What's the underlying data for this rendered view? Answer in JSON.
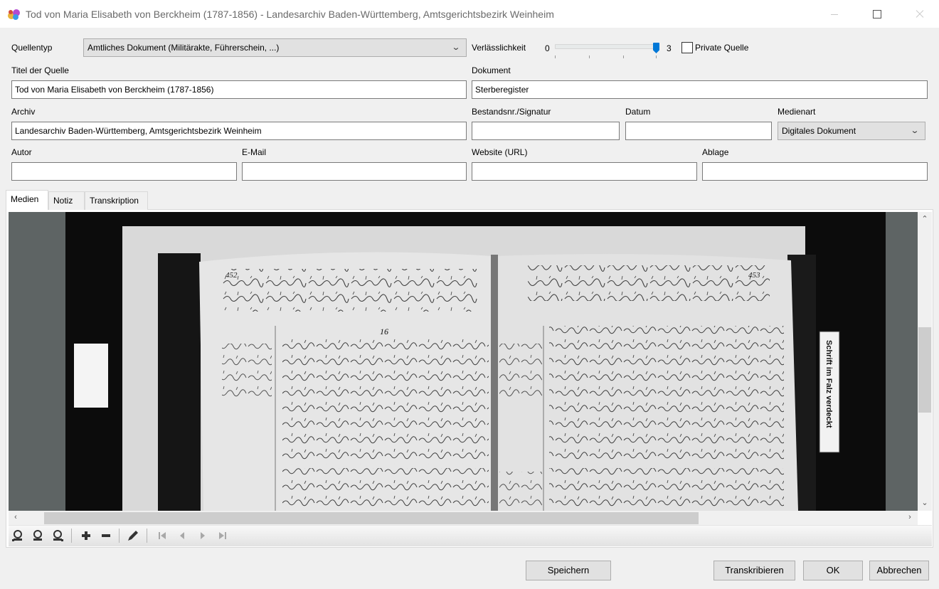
{
  "window": {
    "title": "Tod von Maria Elisabeth von Berckheim (1787-1856) - Landesarchiv Baden-Württemberg, Amtsgerichtsbezirk Weinheim"
  },
  "form": {
    "quellentyp": {
      "label": "Quellentyp",
      "value": "Amtliches Dokument (Militärakte, Führerschein, ...)"
    },
    "verlaesslichkeit": {
      "label": "Verlässlichkeit",
      "min": "0",
      "max": "3",
      "value": 3
    },
    "private_quelle": {
      "label": "Private Quelle",
      "checked": false
    },
    "titel": {
      "label": "Titel der Quelle",
      "value": "Tod von Maria Elisabeth von Berckheim (1787-1856)"
    },
    "dokument": {
      "label": "Dokument",
      "value": "Sterberegister"
    },
    "archiv": {
      "label": "Archiv",
      "value": "Landesarchiv Baden-Württemberg, Amtsgerichtsbezirk Weinheim"
    },
    "bestandsnr": {
      "label": "Bestandsnr./Signatur",
      "value": ""
    },
    "datum": {
      "label": "Datum",
      "value": ""
    },
    "medienart": {
      "label": "Medienart",
      "value": "Digitales Dokument"
    },
    "autor": {
      "label": "Autor",
      "value": ""
    },
    "email": {
      "label": "E-Mail",
      "value": ""
    },
    "website": {
      "label": "Website (URL)",
      "value": ""
    },
    "ablage": {
      "label": "Ablage",
      "value": ""
    }
  },
  "tabs": [
    {
      "label": "Medien",
      "active": true
    },
    {
      "label": "Notiz",
      "active": false
    },
    {
      "label": "Transkription",
      "active": false
    }
  ],
  "document_image": {
    "page_number_left": "452",
    "page_number_right": "453",
    "entry_number": "16",
    "side_note": "Schrift im Falz verdeckt"
  },
  "toolbar_icons": [
    "zoom-fit-icon",
    "zoom-in-icon",
    "zoom-out-icon",
    "add-icon",
    "remove-icon",
    "edit-icon",
    "first-page-icon",
    "prev-page-icon",
    "next-page-icon",
    "last-page-icon"
  ],
  "buttons": {
    "speichern": "Speichern",
    "transkribieren": "Transkribieren",
    "ok": "OK",
    "abbrechen": "Abbrechen"
  },
  "colors": {
    "accent": "#0078d7",
    "window_bg": "#f0f0f0",
    "viewer_bg": "#5e6464"
  }
}
